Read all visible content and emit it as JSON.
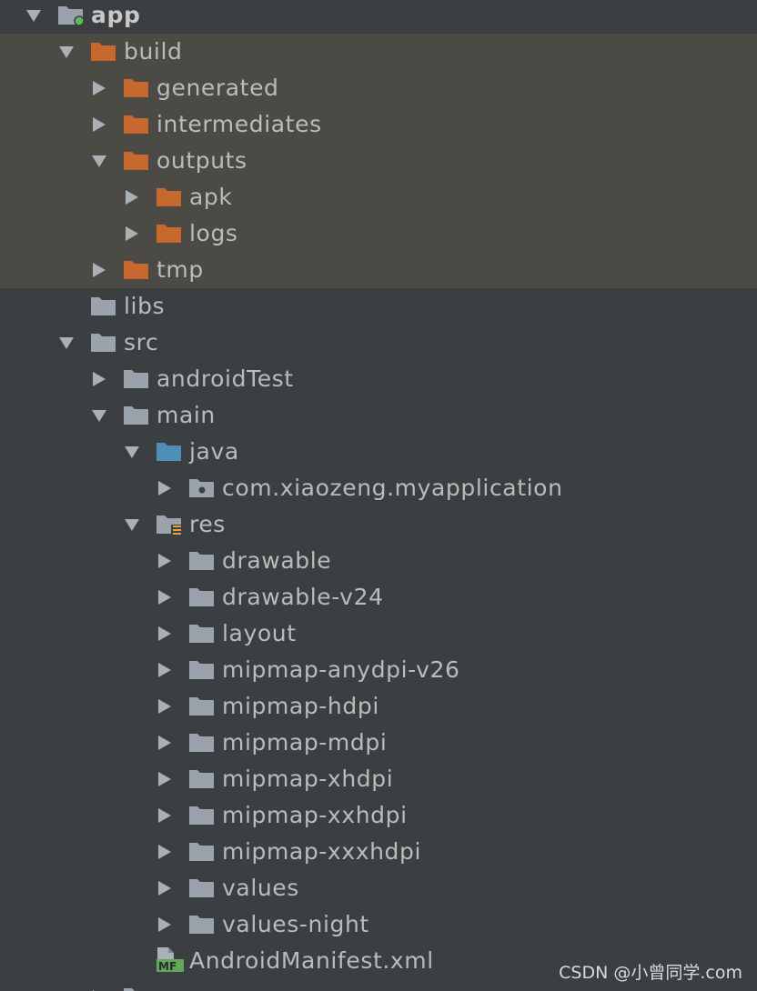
{
  "colors": {
    "background": "#3c3f41",
    "highlight": "#4b4a44",
    "text": "#bbbbbb",
    "folder_gray": "#9aa3ab",
    "folder_orange": "#c7692f",
    "folder_blue": "#4f8fb5",
    "module_dot": "#5fb85f"
  },
  "tree": {
    "rows": [
      {
        "label": "app",
        "arrow": "down",
        "icon": "module-folder-icon"
      },
      {
        "label": "build",
        "arrow": "down",
        "icon": "excluded-folder-icon"
      },
      {
        "label": "generated",
        "arrow": "right",
        "icon": "excluded-folder-icon"
      },
      {
        "label": "intermediates",
        "arrow": "right",
        "icon": "excluded-folder-icon"
      },
      {
        "label": "outputs",
        "arrow": "down",
        "icon": "excluded-folder-icon"
      },
      {
        "label": "apk",
        "arrow": "right",
        "icon": "excluded-folder-icon"
      },
      {
        "label": "logs",
        "arrow": "right",
        "icon": "excluded-folder-icon"
      },
      {
        "label": "tmp",
        "arrow": "right",
        "icon": "excluded-folder-icon"
      },
      {
        "label": "libs",
        "arrow": "none",
        "icon": "folder-icon"
      },
      {
        "label": "src",
        "arrow": "down",
        "icon": "folder-icon"
      },
      {
        "label": "androidTest",
        "arrow": "right",
        "icon": "folder-icon"
      },
      {
        "label": "main",
        "arrow": "down",
        "icon": "folder-icon"
      },
      {
        "label": "java",
        "arrow": "down",
        "icon": "source-root-folder-icon"
      },
      {
        "label": "com.xiaozeng.myapplication",
        "arrow": "right",
        "icon": "package-icon"
      },
      {
        "label": "res",
        "arrow": "down",
        "icon": "resource-folder-icon"
      },
      {
        "label": "drawable",
        "arrow": "right",
        "icon": "folder-icon"
      },
      {
        "label": "drawable-v24",
        "arrow": "right",
        "icon": "folder-icon"
      },
      {
        "label": "layout",
        "arrow": "right",
        "icon": "folder-icon"
      },
      {
        "label": "mipmap-anydpi-v26",
        "arrow": "right",
        "icon": "folder-icon"
      },
      {
        "label": "mipmap-hdpi",
        "arrow": "right",
        "icon": "folder-icon"
      },
      {
        "label": "mipmap-mdpi",
        "arrow": "right",
        "icon": "folder-icon"
      },
      {
        "label": "mipmap-xhdpi",
        "arrow": "right",
        "icon": "folder-icon"
      },
      {
        "label": "mipmap-xxhdpi",
        "arrow": "right",
        "icon": "folder-icon"
      },
      {
        "label": "mipmap-xxxhdpi",
        "arrow": "right",
        "icon": "folder-icon"
      },
      {
        "label": "values",
        "arrow": "right",
        "icon": "folder-icon"
      },
      {
        "label": "values-night",
        "arrow": "right",
        "icon": "folder-icon"
      },
      {
        "label": "AndroidManifest.xml",
        "arrow": "none",
        "icon": "manifest-file-icon"
      }
    ]
  },
  "watermark": "CSDN @小曾同学.com"
}
